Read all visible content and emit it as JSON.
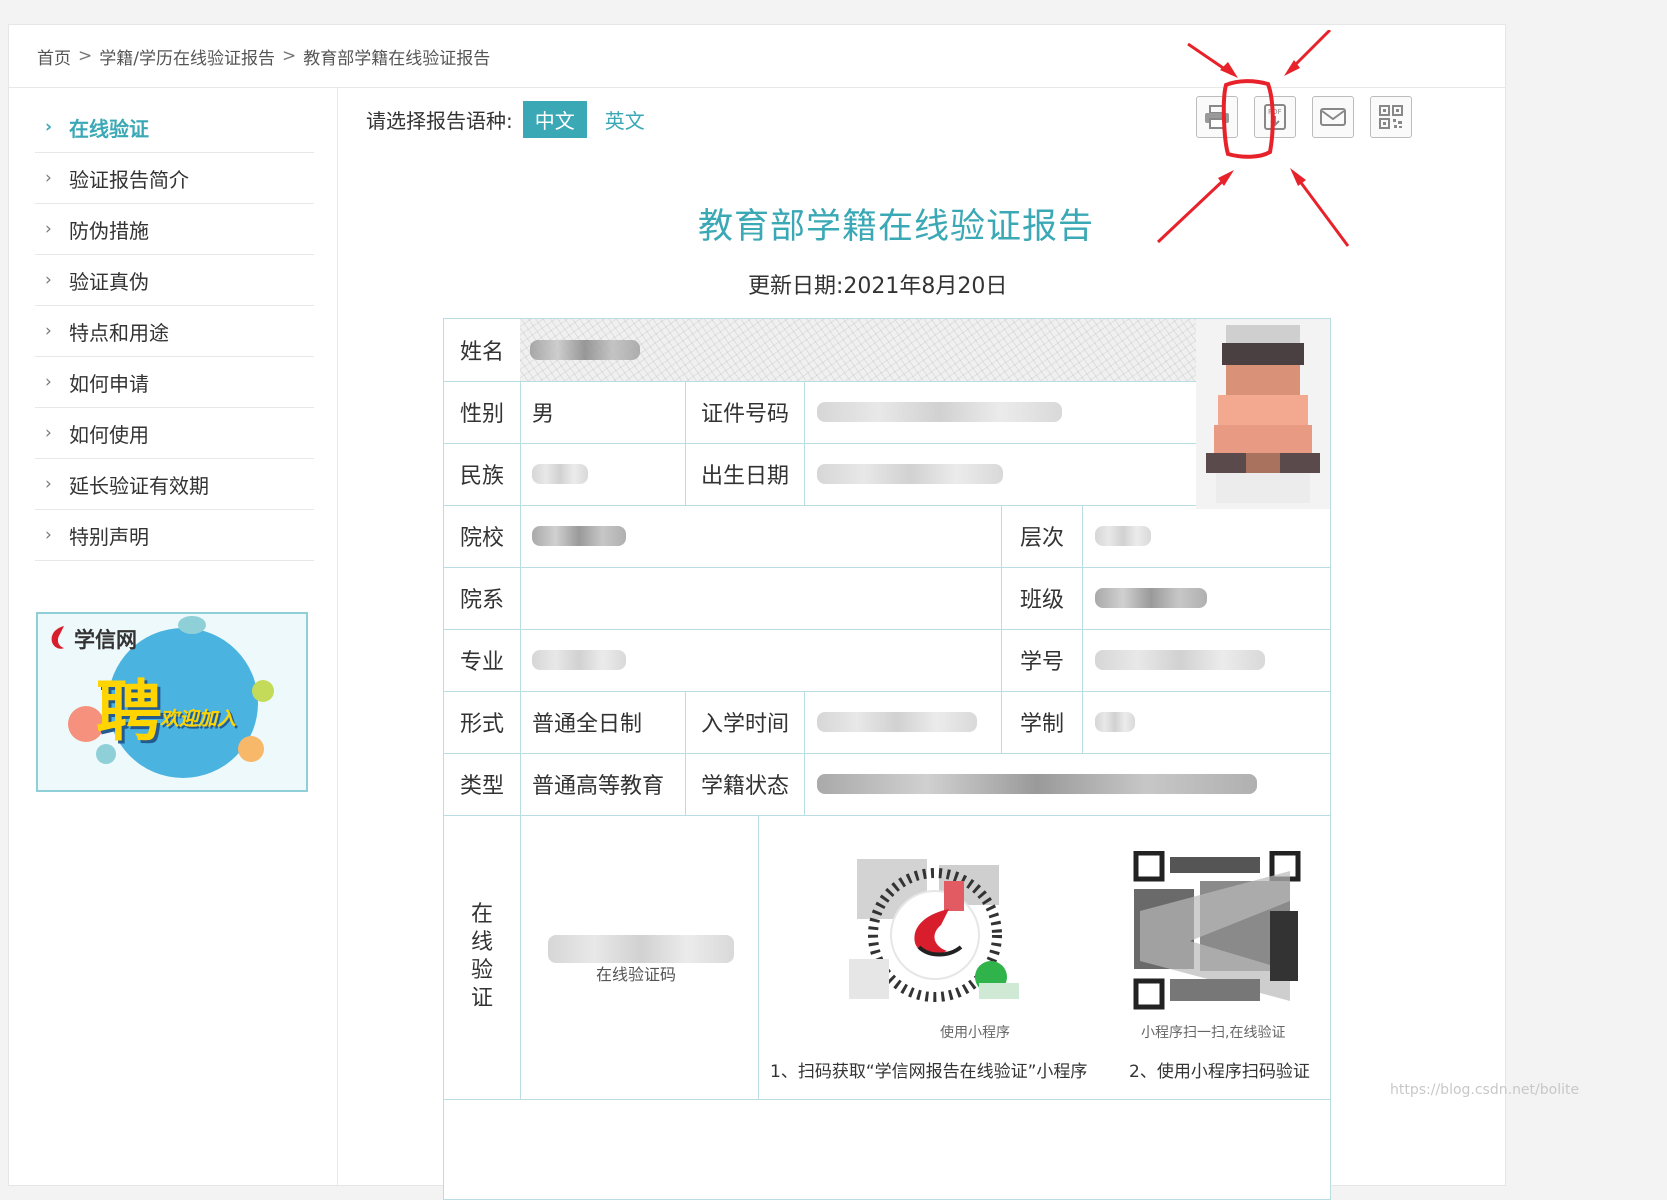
{
  "breadcrumb": {
    "home": "首页",
    "sep1": ">",
    "level2": "学籍/学历在线验证报告",
    "sep2": ">",
    "current": "教育部学籍在线验证报告"
  },
  "sidebar": {
    "items": [
      {
        "label": "在线验证",
        "active": true
      },
      {
        "label": "验证报告简介",
        "active": false
      },
      {
        "label": "防伪措施",
        "active": false
      },
      {
        "label": "验证真伪",
        "active": false
      },
      {
        "label": "特点和用途",
        "active": false
      },
      {
        "label": "如何申请",
        "active": false
      },
      {
        "label": "如何使用",
        "active": false
      },
      {
        "label": "延长验证有效期",
        "active": false
      },
      {
        "label": "特别声明",
        "active": false
      }
    ],
    "chevron": "›",
    "banner": {
      "logo_text": "学信网",
      "headline": "聘",
      "slogan": "欢迎加入"
    }
  },
  "main": {
    "lang_prompt": "请选择报告语种:",
    "lang_zh": "中文",
    "lang_en": "英文",
    "tools": [
      {
        "name": "print-icon"
      },
      {
        "name": "pdf-download-icon"
      },
      {
        "name": "email-icon"
      },
      {
        "name": "qrcode-icon"
      }
    ],
    "title": "教育部学籍在线验证报告",
    "update_date": "更新日期:2021年8月20日"
  },
  "report": {
    "name_label": "姓名",
    "gender_label": "性别",
    "gender_value": "男",
    "id_label": "证件号码",
    "ethnicity_label": "民族",
    "birth_label": "出生日期",
    "school_label": "院校",
    "level_label": "层次",
    "department_label": "院系",
    "class_label": "班级",
    "major_label": "专业",
    "student_id_label": "学号",
    "form_label": "形式",
    "form_value": "普通全日制",
    "enroll_label": "入学时间",
    "duration_label": "学制",
    "type_label": "类型",
    "type_value": "普通高等教育",
    "status_label": "学籍状态",
    "verify_label_chars": [
      "在",
      "线",
      "验",
      "证"
    ],
    "verify_code_caption": "在线验证码",
    "mini_program_caption": "使用小程序",
    "scan_caption": "小程序扫一扫,在线验证",
    "step1": "1、扫码获取“学信网报告在线验证”小程序",
    "step2": "2、使用小程序扫码验证"
  },
  "colors": {
    "accent": "#3aa8b5",
    "annotation_red": "#e8222a",
    "table_border": "#b9dde3"
  },
  "watermark": "https://blog.csdn.net/bolite"
}
